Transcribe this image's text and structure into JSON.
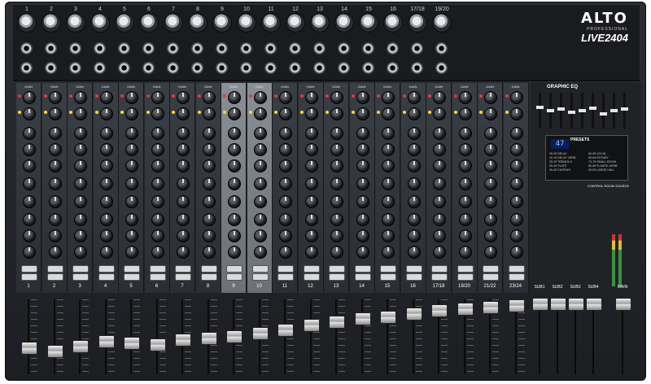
{
  "brand": {
    "logo": "ALTO",
    "sub": "PROFESSIONAL",
    "model": "LIVE2404"
  },
  "io_numbers": [
    "1",
    "2",
    "3",
    "4",
    "5",
    "6",
    "7",
    "8",
    "9",
    "10",
    "11",
    "12",
    "13",
    "14",
    "15",
    "16",
    "17/18",
    "19/20"
  ],
  "channels": [
    "1",
    "2",
    "3",
    "4",
    "5",
    "6",
    "7",
    "8",
    "9",
    "10",
    "11",
    "12",
    "13",
    "14",
    "15",
    "16",
    "17/18",
    "19/20",
    "21/22",
    "23/24"
  ],
  "labels": {
    "gain": "GAIN",
    "graphic_eq": "GRAPHIC EQ",
    "presets": "PRESETS",
    "control_room": "CONTROL ROOM SOURCE",
    "main": "MAIN"
  },
  "fx": {
    "display": "47",
    "presets": [
      "00-09 DELAY",
      "10-19 DELAY VERB",
      "20-29 TREMOLO",
      "30-39 PLATE",
      "40-49 CHORUS",
      "50-59 VOCAL",
      "60-69 ROTARY",
      "70-79 SMALL ROOM",
      "80-89 FLANGE-VERB",
      "90-99 LARGE HALL"
    ]
  },
  "subs": [
    "SUB1",
    "SUB2",
    "SUB3",
    "SUB4"
  ],
  "colors": {
    "panel": "#2b2e34",
    "lit_strip": "#7a7f86",
    "accent_red": "#e53935",
    "led_yellow": "#fdd835",
    "led_green": "#43a047"
  }
}
